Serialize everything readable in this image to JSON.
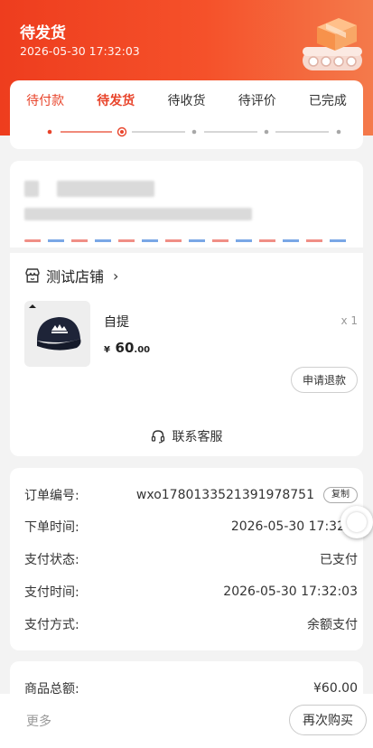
{
  "header": {
    "status_title": "待发货",
    "timestamp": "2026-05-30 17:32:03"
  },
  "status_tabs": {
    "items": [
      {
        "label": "待付款",
        "state": "done"
      },
      {
        "label": "待发货",
        "state": "active"
      },
      {
        "label": "待收货",
        "state": "pending"
      },
      {
        "label": "待评价",
        "state": "pending"
      },
      {
        "label": "已完成",
        "state": "pending"
      }
    ],
    "accent_color": "#e8432a",
    "pending_color": "#a8a8a8"
  },
  "address": {
    "recipient_name": "",
    "phone": "",
    "detail": ""
  },
  "shop": {
    "name": "测试店铺",
    "icon": "store-icon"
  },
  "product": {
    "name": "自提",
    "quantity": "x 1",
    "price_currency": "¥",
    "price_integer": "60",
    "price_decimal": ".00",
    "image_icon": "baseball-cap-image"
  },
  "actions": {
    "refund_label": "申请退款",
    "customer_service_label": "联系客服",
    "copy_label": "复制",
    "more_label": "更多",
    "buy_again_label": "再次购买"
  },
  "order_info": {
    "order_number_label": "订单编号:",
    "order_number_value": "wxo1780133521391978751",
    "order_time_label": "下单时间:",
    "order_time_value": "2026-05-30 17:32",
    "payment_status_label": "支付状态:",
    "payment_status_value": "已支付",
    "payment_time_label": "支付时间:",
    "payment_time_value": "2026-05-30 17:32:03",
    "payment_method_label": "支付方式:",
    "payment_method_value": "余额支付"
  },
  "totals": {
    "goods_total_label": "商品总额:",
    "goods_total_value": "¥60.00"
  },
  "colors": {
    "brand": "#ee3d1e",
    "accent": "#e8432a"
  }
}
